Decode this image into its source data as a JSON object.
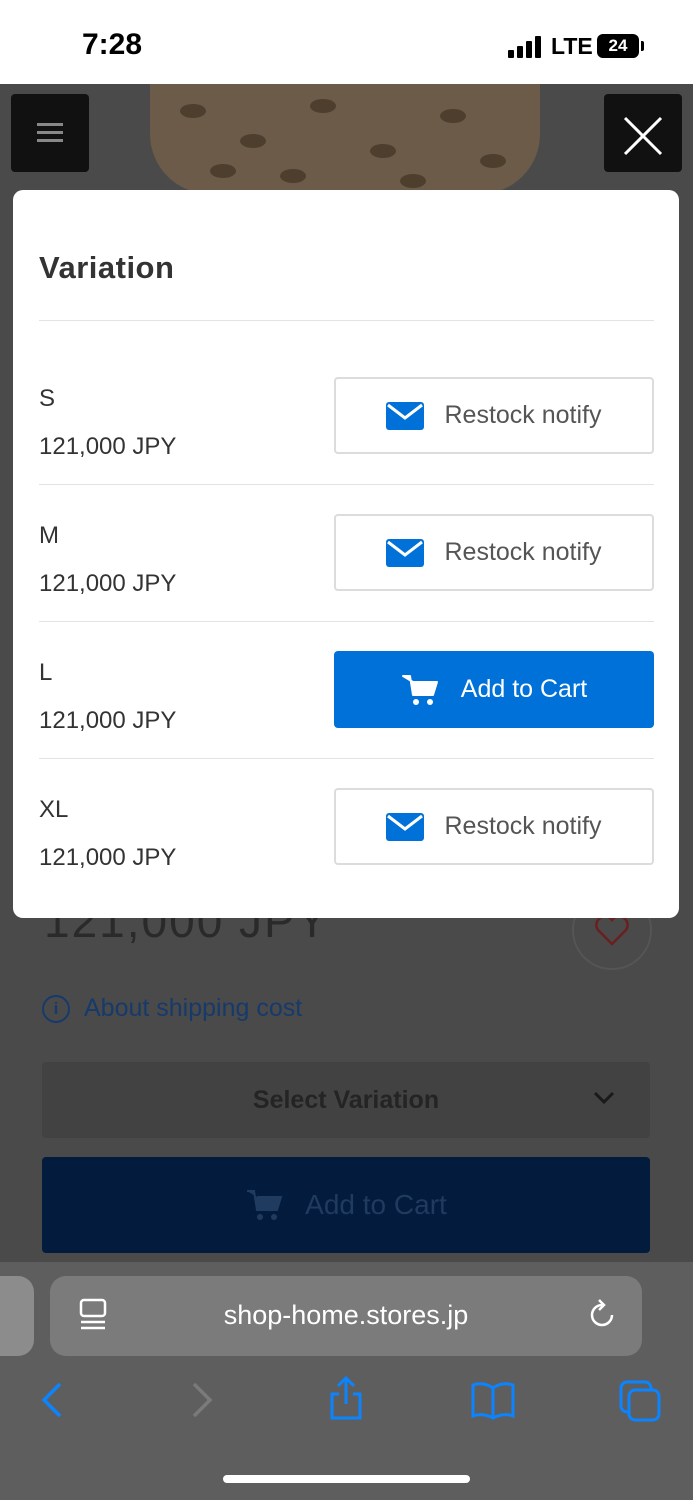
{
  "status_bar": {
    "time": "7:28",
    "network": "LTE",
    "battery": "24"
  },
  "modal": {
    "title": "Variation",
    "variations": [
      {
        "size": "S",
        "price": "121,000 JPY",
        "action": "Restock notify",
        "action_type": "notify"
      },
      {
        "size": "M",
        "price": "121,000 JPY",
        "action": "Restock notify",
        "action_type": "notify"
      },
      {
        "size": "L",
        "price": "121,000 JPY",
        "action": "Add to Cart",
        "action_type": "cart"
      },
      {
        "size": "XL",
        "price": "121,000 JPY",
        "action": "Restock notify",
        "action_type": "notify"
      }
    ]
  },
  "background_page": {
    "price": "121,000 JPY",
    "shipping_link": "About shipping cost",
    "select_variation": "Select Variation",
    "add_to_cart": "Add to Cart"
  },
  "browser": {
    "url": "shop-home.stores.jp"
  },
  "colors": {
    "accent": "#0071d8",
    "overlay_dim": "#4a4a4a"
  },
  "icons": [
    "menu-icon",
    "close-icon",
    "mail-icon",
    "cart-icon",
    "heart-icon",
    "info-icon",
    "chevron-down-icon",
    "reader-mode-icon",
    "reload-icon",
    "back-icon",
    "forward-icon",
    "share-icon",
    "bookmarks-icon",
    "tabs-icon"
  ]
}
